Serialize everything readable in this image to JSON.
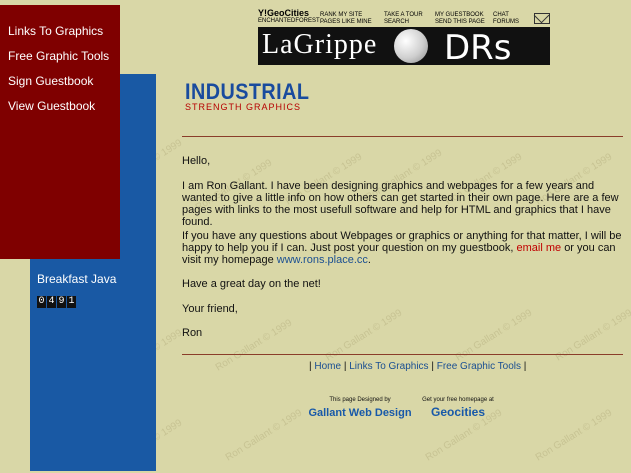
{
  "watermark": "Ron Gallant © 1999",
  "nav": {
    "links": [
      "Links To Graphics",
      "Free Graphic Tools",
      "Sign Guestbook",
      "View Guestbook"
    ]
  },
  "sidebar": {
    "breakfast": "Breakfast Java",
    "counter": [
      "0",
      "4",
      "9",
      "1"
    ]
  },
  "geocities_bar": {
    "logo": "Y!GeoCities",
    "site_name": "ENCHANTEDFOREST",
    "rank": "RANK MY SITE",
    "pages": "PAGES LIKE MINE",
    "tour": "TAKE A TOUR",
    "search": "SEARCH",
    "guestbook": "MY GUESTBOOK",
    "send": "SEND THIS PAGE",
    "chat": "CHAT",
    "forums": "FORUMS"
  },
  "banner": {
    "left": "LaGrippe",
    "right": "DRs"
  },
  "header": {
    "title": "INDUSTRIAL",
    "subtitle": "STRENGTH GRAPHICS"
  },
  "content": {
    "greeting": "Hello,",
    "p1": "I am Ron Gallant. I have been designing graphics and webpages for a few years and wanted to give a little info on how others can get started in their own page. Here are a few pages with links to the most usefull software and help for HTML and graphics that I have found.",
    "p2_before": "If you have any questions about Webpages or graphics or anything for that matter, I will be happy to help you if I can. Just post your question on my guestbook,",
    "email": "email me",
    "p2_middle": "or you can visit my homepage",
    "homepage": "www.rons.place.cc",
    "p2_after": ".",
    "day": "Have a great day on the net!",
    "closing": "Your friend,",
    "name": "Ron"
  },
  "footer": {
    "home": "Home",
    "links": "Links To Graphics",
    "tools": "Free Graphic Tools",
    "designed_small": "This page Designed by",
    "designed_big": "Gallant Web Design",
    "geo_small": "Get your free homepage at",
    "geo_big": "Geocities"
  }
}
